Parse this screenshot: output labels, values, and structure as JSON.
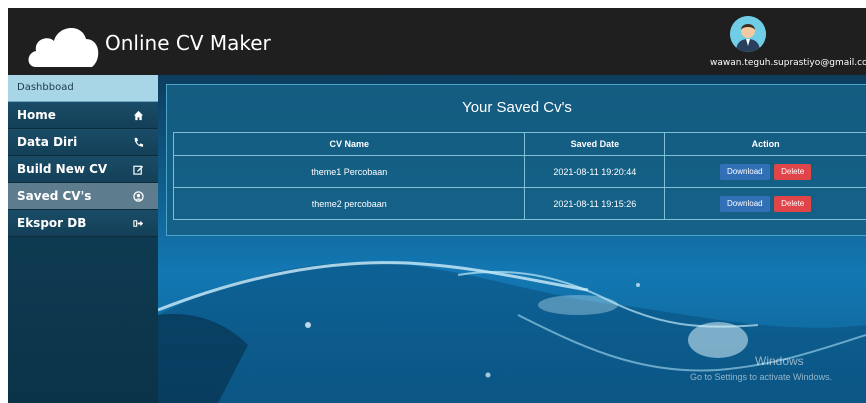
{
  "header": {
    "app_title": "Online CV Maker",
    "user_email": "wawan.teguh.suprastiyo@gmail.com"
  },
  "sidebar": {
    "header_label": "Dashbboad",
    "items": [
      {
        "label": "Home",
        "icon": "home-icon"
      },
      {
        "label": "Data Diri",
        "icon": "phone-icon"
      },
      {
        "label": "Build New CV",
        "icon": "edit-icon"
      },
      {
        "label": "Saved CV's",
        "icon": "user-circle-icon"
      },
      {
        "label": "Ekspor DB",
        "icon": "sign-out-icon"
      }
    ],
    "active_index": 3
  },
  "main": {
    "title": "Your Saved Cv's",
    "table": {
      "headers": [
        "CV Name",
        "Saved Date",
        "Action"
      ],
      "rows": [
        {
          "name": "theme1 Percobaan",
          "date": "2021-08-11 19:20:44",
          "download": "Download",
          "delete": "Delete"
        },
        {
          "name": "theme2 percobaan",
          "date": "2021-08-11 19:15:26",
          "download": "Download",
          "delete": "Delete"
        }
      ]
    }
  },
  "watermark": {
    "line1": "Windows",
    "line2": "Go to Settings to activate Windows."
  },
  "colors": {
    "topbar": "#1f1f1f",
    "download_button": "#3170b7",
    "delete_button": "#e0454a"
  }
}
